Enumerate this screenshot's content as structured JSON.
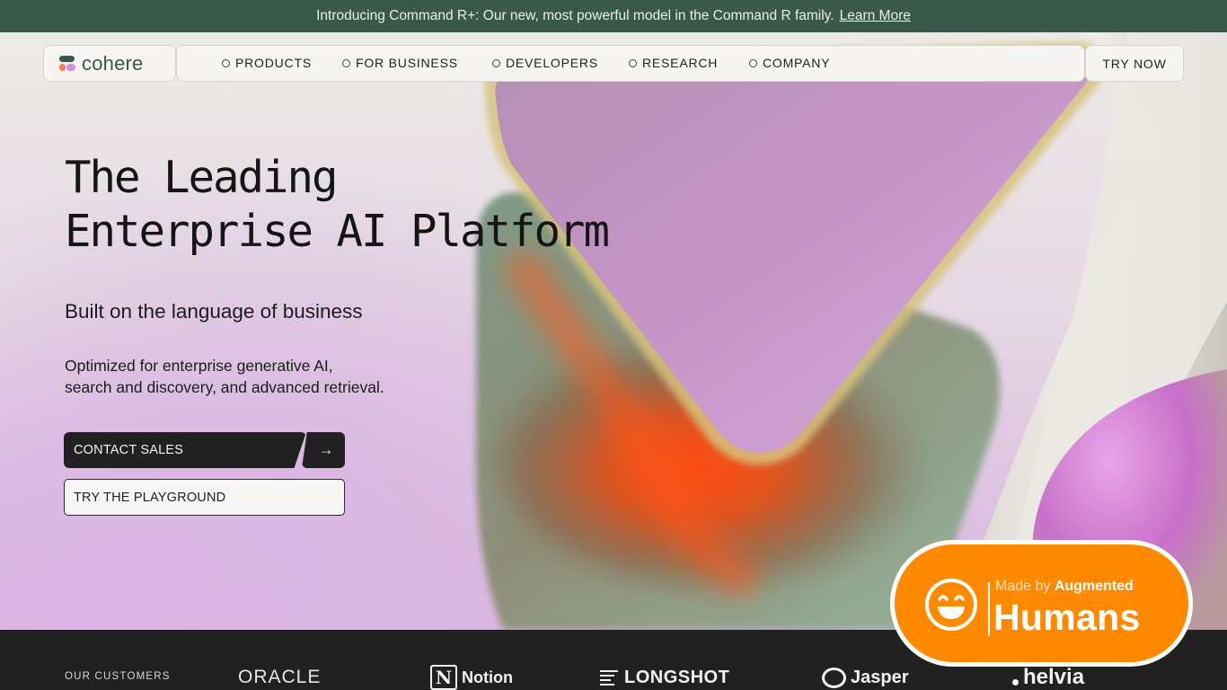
{
  "announcement": {
    "text": "Introducing Command R+: Our new, most powerful model in the Command R family.",
    "link": "Learn More"
  },
  "brand": {
    "name": "cohere",
    "colors": {
      "green": "#39594d",
      "coral": "#ff7759",
      "lilac": "#d18ee2"
    }
  },
  "nav": {
    "items": [
      {
        "label": "PRODUCTS"
      },
      {
        "label": "FOR BUSINESS"
      },
      {
        "label": "DEVELOPERS"
      },
      {
        "label": "RESEARCH"
      },
      {
        "label": "COMPANY"
      }
    ],
    "cta": "TRY NOW"
  },
  "hero": {
    "headline_line1": "The Leading",
    "headline_line2": "Enterprise AI Platform",
    "subheadline": "Built on the language of business",
    "body_line1": "Optimized for enterprise generative AI,",
    "body_line2": "search and discovery, and advanced retrieval.",
    "primary_cta": "CONTACT SALES",
    "arrow_icon": "arrow-right-icon",
    "secondary_cta": "TRY THE PLAYGROUND"
  },
  "customers": {
    "label": "OUR CUSTOMERS",
    "logos": [
      {
        "name": "ORACLE"
      },
      {
        "name": "Notion",
        "mark": "N"
      },
      {
        "name": "LONGSHOT"
      },
      {
        "name": "Jasper"
      },
      {
        "name": "helvia"
      }
    ]
  },
  "badge": {
    "prefix": "Made by",
    "emphasis": "Augmented",
    "title": "Humans",
    "icon": "smiley-face-icon",
    "color": "#ff8a00"
  }
}
